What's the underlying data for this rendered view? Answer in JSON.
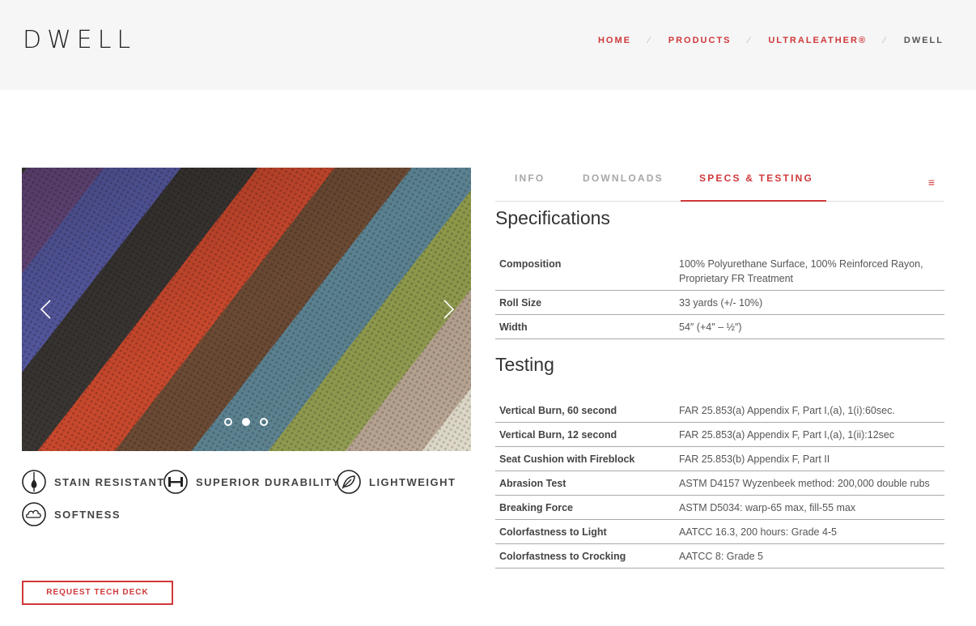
{
  "logo": "DWELL",
  "breadcrumb": {
    "items": [
      "HOME",
      "PRODUCTS",
      "ULTRALEATHER®"
    ],
    "separator": "⁄",
    "current": "DWELL"
  },
  "slider": {
    "slide_count": 3,
    "active_index": 1,
    "swatch_colors": [
      "#6e4e86",
      "#5a5da8",
      "#3a3633",
      "#c8482d",
      "#6b4a34",
      "#5b8291",
      "#8f9a4b",
      "#b5a08d",
      "#dcd6c4",
      "#e8cc8c",
      "#f3e5c4"
    ]
  },
  "features": [
    {
      "label": "STAIN RESISTANT",
      "icon": "stain-resistant-icon"
    },
    {
      "label": "SUPERIOR DURABILITY",
      "icon": "dumbbell-icon"
    },
    {
      "label": "LIGHTWEIGHT",
      "icon": "feather-icon"
    },
    {
      "label": "SOFTNESS",
      "icon": "cloud-icon"
    }
  ],
  "cta_label": "REQUEST TECH DECK",
  "tabs": [
    {
      "label": "INFO"
    },
    {
      "label": "DOWNLOADS"
    },
    {
      "label": "SPECS & TESTING"
    }
  ],
  "active_tab": "SPECS & TESTING",
  "menu_icon": "≡",
  "specifications": {
    "title": "Specifications",
    "rows": [
      {
        "label": "Composition",
        "value": "100% Polyurethane Surface, 100% Reinforced Rayon, Proprietary FR Treatment"
      },
      {
        "label": "Roll Size",
        "value": "33 yards (+/- 10%)"
      },
      {
        "label": "Width",
        "value": "54″ (+4″ – ½″)"
      }
    ]
  },
  "testing": {
    "title": "Testing",
    "rows": [
      {
        "label": "Vertical Burn, 60 second",
        "value": "FAR 25.853(a) Appendix F, Part I,(a), 1(i):60sec."
      },
      {
        "label": "Vertical Burn, 12 second",
        "value": "FAR 25.853(a) Appendix F, Part I,(a), 1(ii):12sec"
      },
      {
        "label": "Seat Cushion with Fireblock",
        "value": "FAR 25.853(b) Appendix F, Part II"
      },
      {
        "label": "Abrasion Test",
        "value": "ASTM D4157 Wyzenbeek method: 200,000 double rubs"
      },
      {
        "label": "Breaking Force",
        "value": "ASTM D5034: warp-65 max, fill-55 max"
      },
      {
        "label": "Colorfastness to Light",
        "value": "AATCC 16.3, 200 hours: Grade 4-5"
      },
      {
        "label": "Colorfastness to Crocking",
        "value": "AATCC 8: Grade 5"
      }
    ]
  },
  "colors": {
    "accent": "#d0383a",
    "header_bg": "#f6f6f6"
  }
}
